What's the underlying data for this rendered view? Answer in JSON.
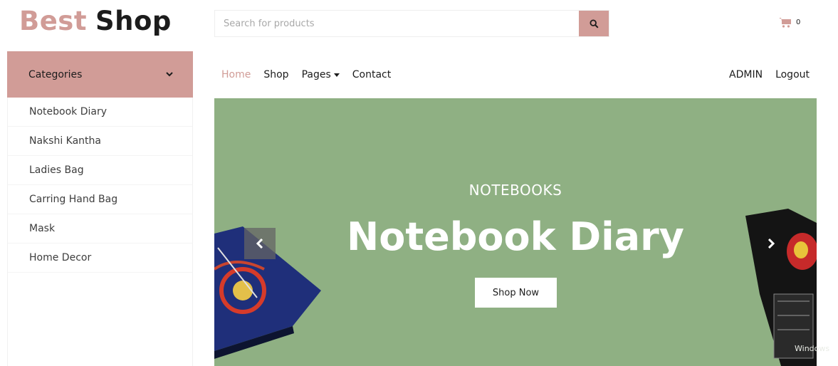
{
  "brand": {
    "word1": "Best",
    "word2": "Shop"
  },
  "search": {
    "placeholder": "Search for products"
  },
  "cart": {
    "count": "0"
  },
  "sidebar": {
    "header": "Categories",
    "items": [
      "Notebook Diary",
      "Nakshi Kantha",
      "Ladies Bag",
      "Carring Hand Bag",
      "Mask",
      "Home Decor"
    ]
  },
  "nav": {
    "links": [
      "Home",
      "Shop",
      "Pages",
      "Contact"
    ],
    "active": "Home",
    "right": [
      "ADMIN",
      "Logout"
    ]
  },
  "banner": {
    "subtitle": "NOTEBOOKS",
    "title": "Notebook Diary",
    "button": "Shop Now"
  },
  "watermark": "Windows",
  "colors": {
    "accent": "#d19c97",
    "banner_bg": "#8fb083",
    "text": "#1c1c1c"
  }
}
